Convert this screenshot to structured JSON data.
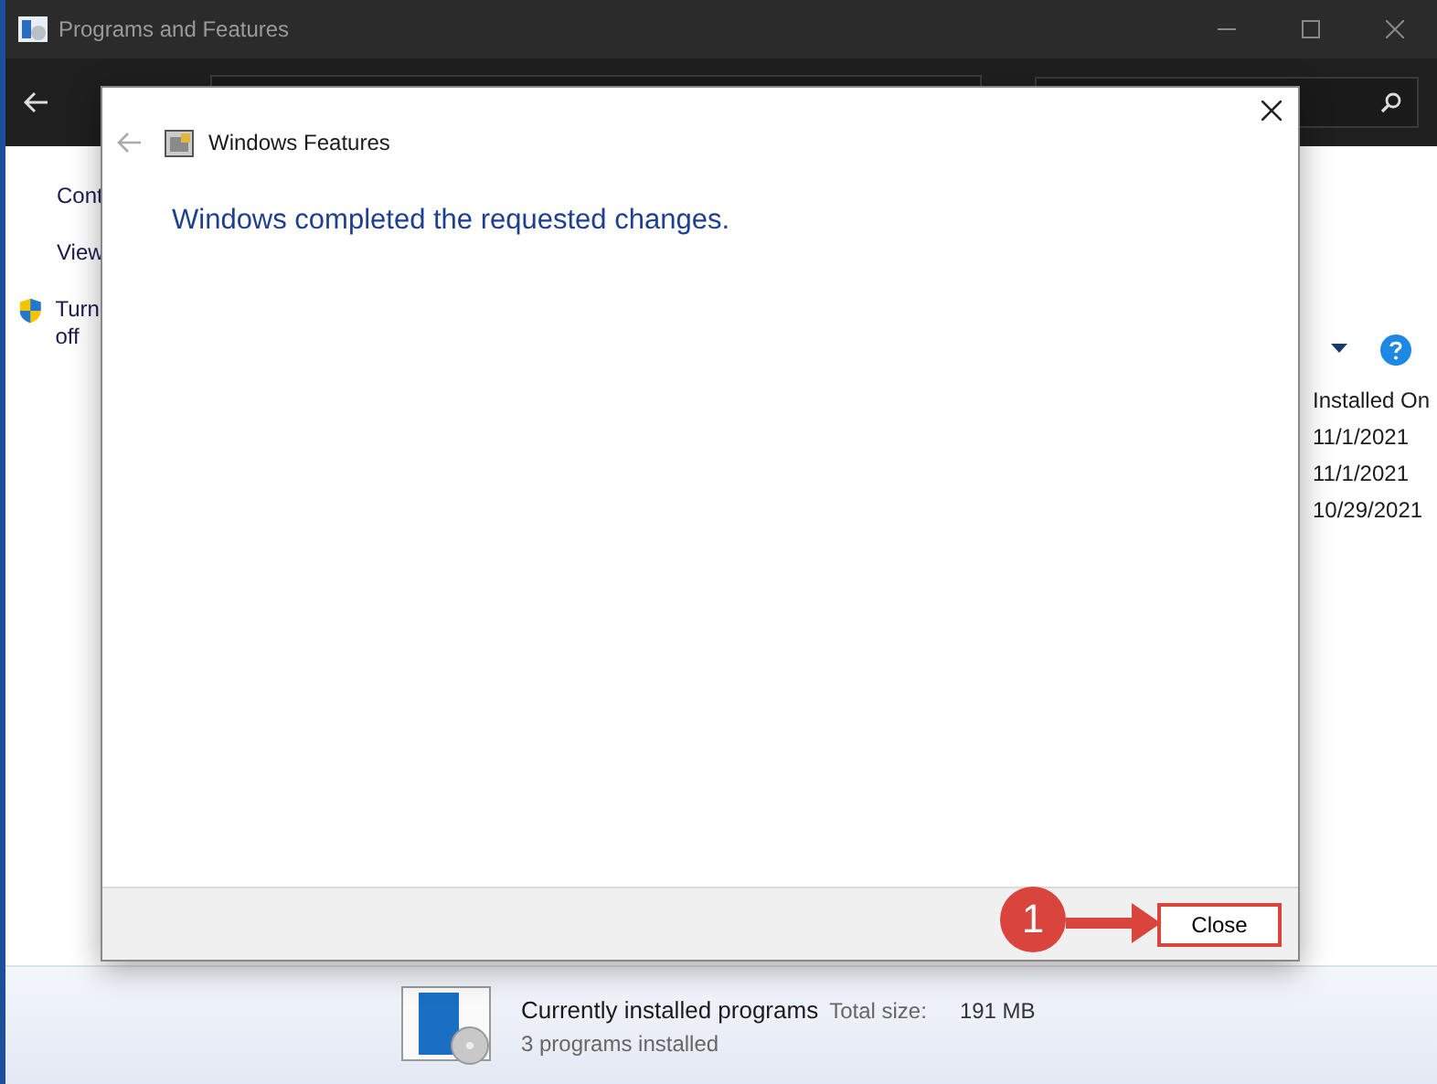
{
  "window": {
    "title": "Programs and Features"
  },
  "sidebar": {
    "items": [
      {
        "label": "Cont",
        "kind": "link"
      },
      {
        "label": "View",
        "kind": "link"
      },
      {
        "label": "Turn off",
        "kind": "shield"
      }
    ]
  },
  "table": {
    "columns": [
      "Installed On"
    ],
    "rows": [
      [
        "11/1/2021"
      ],
      [
        "11/1/2021"
      ],
      [
        "10/29/2021"
      ]
    ]
  },
  "details": {
    "title": "Currently installed programs",
    "size_label": "Total size:",
    "size_value": "191 MB",
    "count": "3 programs installed"
  },
  "dialog": {
    "title": "Windows Features",
    "message": "Windows completed the requested changes.",
    "button": "Close"
  },
  "annotation": {
    "label": "1"
  }
}
